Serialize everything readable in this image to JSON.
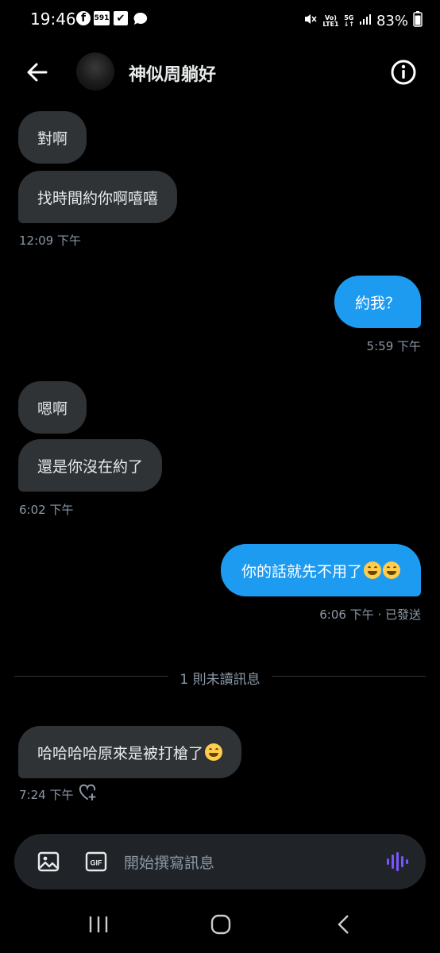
{
  "status_bar": {
    "time": "19:46",
    "icons": [
      "facebook-icon",
      "591-app-icon",
      "checkbox-icon",
      "chat-icon"
    ],
    "network": {
      "volte": "Vo)\nLTE1",
      "gen": "5G"
    },
    "battery": "83%"
  },
  "header": {
    "title": "神似周躺好",
    "back_icon": "arrow-left-icon",
    "info_icon": "info-icon"
  },
  "messages": [
    {
      "dir": "in",
      "text": "對啊"
    },
    {
      "dir": "in",
      "text": "找時間約你啊嘻嘻",
      "time": "12:09 下午"
    },
    {
      "dir": "out",
      "text": "約我？",
      "time": "5:59 下午"
    },
    {
      "dir": "in",
      "text": "嗯啊"
    },
    {
      "dir": "in",
      "text": "還是你沒在約了",
      "time": "6:02 下午"
    },
    {
      "dir": "out",
      "text": "你的話就先不用了",
      "emoji": "😅😅",
      "time": "6:06 下午 · 已發送"
    },
    {
      "dir": "in",
      "text": "哈哈哈哈原來是被打槍了",
      "emoji": "😅",
      "time": "7:24 下午"
    }
  ],
  "unread_divider": "1 則未讀訊息",
  "composer": {
    "placeholder": "開始撰寫訊息",
    "gif_label": "GIF",
    "icons": [
      "image-icon",
      "gif-icon",
      "voice-icon"
    ]
  },
  "colors": {
    "background": "#000000",
    "incoming_bubble": "#2f3336",
    "outgoing_bubble": "#1d9bf0",
    "muted_text": "#8b98a5",
    "voice_accent": "#7856ff"
  }
}
